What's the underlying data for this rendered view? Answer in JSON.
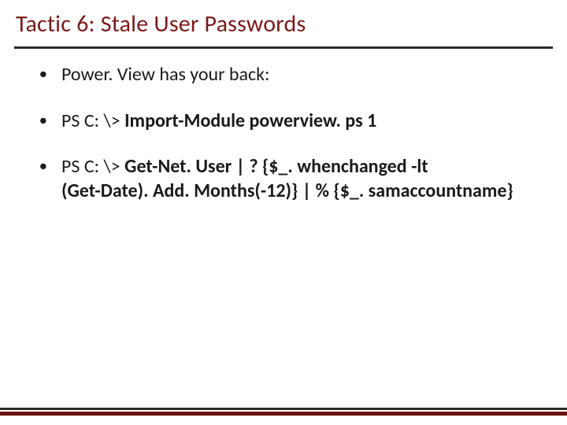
{
  "title": "Tactic 6: Stale User Passwords",
  "bullets": {
    "intro": "Power. View has your back:",
    "cmd1_prefix": "PS C: \\> ",
    "cmd1_bold": "Import-Module powerview. ps 1",
    "cmd2_prefix": "PS C: \\> ",
    "cmd2_bold_line1": "Get-Net. User | ? {$_. whenchanged -lt",
    "cmd2_bold_line2": "(Get-Date). Add. Months(-12)} | % {$_. samaccountname}"
  }
}
